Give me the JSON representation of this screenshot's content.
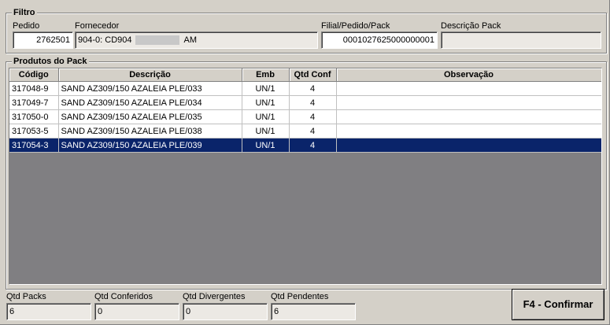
{
  "filtro": {
    "legend": "Filtro",
    "pedido_label": "Pedido",
    "pedido_value": "2762501",
    "fornecedor_label": "Fornecedor",
    "fornecedor_prefix": "904-0: CD904",
    "fornecedor_suffix": "AM",
    "filial_label": "Filial/Pedido/Pack",
    "filial_value": "0001027625000000001",
    "descricao_pack_label": "Descrição Pack",
    "descricao_pack_value": ""
  },
  "produtos": {
    "legend": "Produtos do Pack",
    "columns": [
      "Código",
      "Descrição",
      "Emb",
      "Qtd Conf",
      "Observação"
    ],
    "rows": [
      {
        "codigo": "317048-9",
        "descricao": "SAND AZ309/150 AZALEIA PLE/033",
        "emb": "UN/1",
        "qtd": "4",
        "obs": ""
      },
      {
        "codigo": "317049-7",
        "descricao": "SAND AZ309/150 AZALEIA PLE/034",
        "emb": "UN/1",
        "qtd": "4",
        "obs": ""
      },
      {
        "codigo": "317050-0",
        "descricao": "SAND AZ309/150 AZALEIA PLE/035",
        "emb": "UN/1",
        "qtd": "4",
        "obs": ""
      },
      {
        "codigo": "317053-5",
        "descricao": "SAND AZ309/150 AZALEIA PLE/038",
        "emb": "UN/1",
        "qtd": "4",
        "obs": ""
      },
      {
        "codigo": "317054-3",
        "descricao": "SAND AZ309/150 AZALEIA PLE/039",
        "emb": "UN/1",
        "qtd": "4",
        "obs": ""
      }
    ],
    "selected_row": 4,
    "selection_color": "#0a246a"
  },
  "totais": {
    "qtd_packs_label": "Qtd Packs",
    "qtd_packs_value": "6",
    "qtd_conferidos_label": "Qtd Conferidos",
    "qtd_conferidos_value": "0",
    "qtd_divergentes_label": "Qtd Divergentes",
    "qtd_divergentes_value": "0",
    "qtd_pendentes_label": "Qtd Pendentes",
    "qtd_pendentes_value": "6"
  },
  "actions": {
    "confirmar_label": "F4 - Confirmar"
  }
}
